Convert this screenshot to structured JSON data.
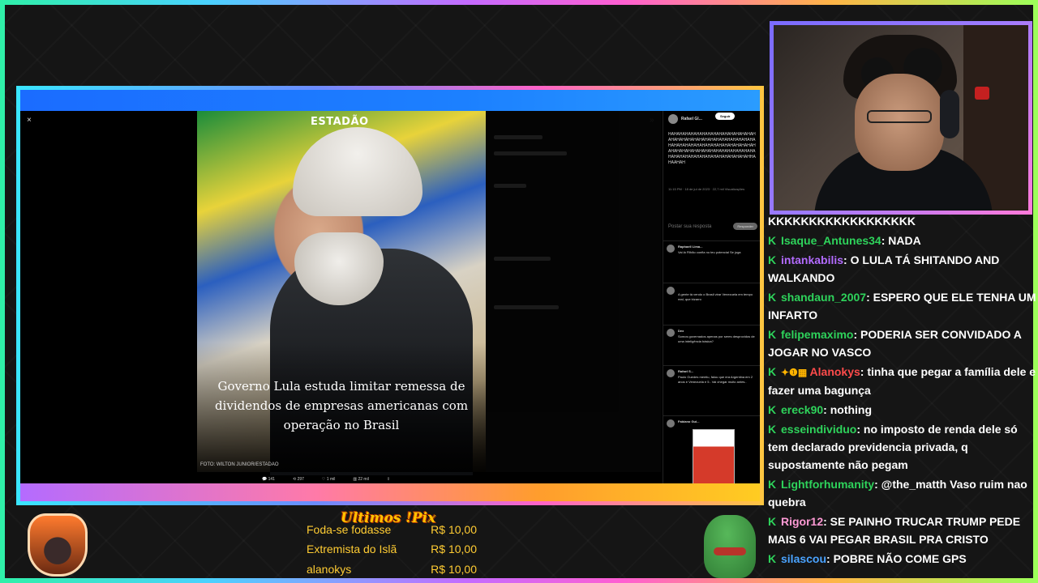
{
  "overlay": {
    "colors": {
      "accent_green": "#2ed35b",
      "pix_gold": "#ffc400"
    }
  },
  "viewer": {
    "close_icon": "×",
    "collapse_icon": "»",
    "brand": "ESTADÃO",
    "headline": "Governo Lula estuda limitar remessa de dividendos de empresas americanas com operação no Brasil",
    "photo_credit": "FOTO: WILTON JUNIOR/ESTADAO",
    "actions": {
      "replies": "141",
      "reposts": "297",
      "likes": "1 mil",
      "views": "22 mil"
    }
  },
  "tweet": {
    "author": "Rafael Gl...",
    "follow_label": "Seguir",
    "body": "HAHAHAHAHAHAHAHAHAHAHAHAHAHAHAHAHAHAHAHAHAHAHAHAHAHAHAHAHAHAHAHAHAHAHAHAHAHAHAHAHAHAHAHAHAHAHAHAHAHAHAHAHAHAHAHAHAHAHAHAHAHAHAHAHAHAHAHAHAHAHAHAHAHAHAHAHHAHAAHAH",
    "meta": "11:15 PM · 18 de jul de 2023 · 22,7 mil Visualizações",
    "reply_placeholder": "Postar sua resposta",
    "reply_button": "Responder",
    "replies": [
      {
        "name": "Raphaell Lima...",
        "text": "Vai lá Filhão confia no teu potencial Se joga"
      },
      {
        "name": "",
        "text": "A gente tá vendo o Brasil virar Venezuela em tempo real, que bizarro"
      },
      {
        "name": "Dex",
        "text": "Somos governados apenas por seres desprovidos de uma inteligência básica?"
      },
      {
        "name": "Rafael S...",
        "text": "Paulo Guedes mentiu, falou que era Argentina em 2 anos e Venezuela e 5.. Vai chegar muito antes.."
      },
      {
        "name": "Fabiano Gui...",
        "text": ""
      }
    ]
  },
  "chat": {
    "top_line": "KKKKKKKKKKKKKKKKKK",
    "messages": [
      {
        "user": "Isaque_Antunes34",
        "color": "#2ed35b",
        "text": ": NADA",
        "badges": ""
      },
      {
        "user": "intankabilis",
        "color": "#b36bff",
        "text": ": O LULA TÁ SHITANDO AND WALKANDO",
        "badges": ""
      },
      {
        "user": "shandaun_2007",
        "color": "#2ed35b",
        "text": ": ESPERO QUE ELE TENHA UM INFARTO",
        "badges": ""
      },
      {
        "user": "felipemaximo",
        "color": "#2ed35b",
        "text": ": PODERIA SER CONVIDADO A JOGAR NO VASCO",
        "badges": ""
      },
      {
        "user": "Alanokys",
        "color": "#ff4b4b",
        "text": ": tinha que pegar a família dele e fazer uma bagunça",
        "badges": "✦❶▦"
      },
      {
        "user": "ereck90",
        "color": "#2ed35b",
        "text": ": nothing",
        "badges": ""
      },
      {
        "user": "esseindividuo",
        "color": "#2ed35b",
        "text": ": no imposto de renda dele só tem declarado previdencia privada, q supostamente não pegam",
        "badges": ""
      },
      {
        "user": "Lightforhumanity",
        "color": "#2ed35b",
        "text": ": @the_matth Vaso ruim nao quebra",
        "badges": ""
      },
      {
        "user": "Rigor12",
        "color": "#ff9ad5",
        "text": ": SE PAINHO TRUCAR TRUMP PEDE MAIS 6 VAI PEGAR BRASIL PRA CRISTO",
        "badges": ""
      },
      {
        "user": "silascou",
        "color": "#4aa3ff",
        "text": ": POBRE NÃO COME GPS",
        "badges": ""
      }
    ]
  },
  "pix": {
    "title": "Ultimos !Pix",
    "rows": [
      {
        "name": "Foda-se fodasse",
        "value": "R$ 10,00"
      },
      {
        "name": "Extremista do Islã",
        "value": "R$ 10,00"
      },
      {
        "name": "alanokys",
        "value": "R$ 10,00"
      }
    ]
  }
}
